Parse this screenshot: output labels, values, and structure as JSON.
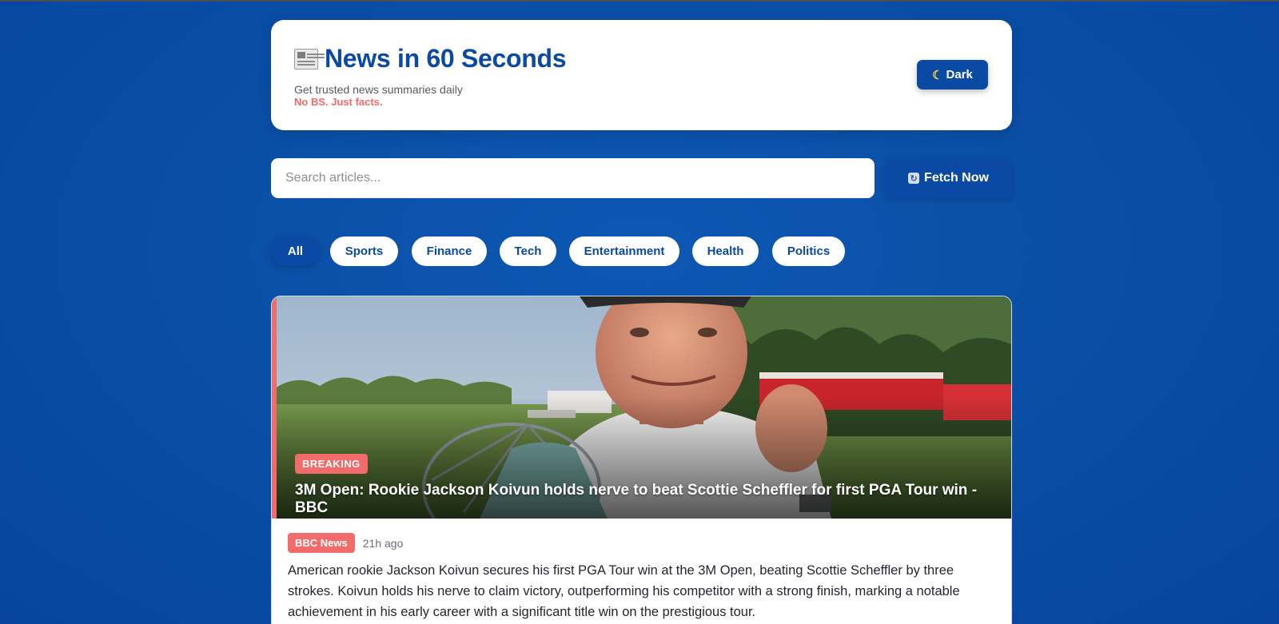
{
  "header": {
    "title": "News in 60 Seconds",
    "subtitle": "Get trusted news summaries daily",
    "tagline": "No BS. Just facts.",
    "dark_button": "Dark",
    "icon": "newspaper-icon"
  },
  "search": {
    "placeholder": "Search articles...",
    "value": "",
    "fetch_label": "Fetch Now"
  },
  "filters": {
    "items": [
      "All",
      "Sports",
      "Finance",
      "Tech",
      "Entertainment",
      "Health",
      "Politics"
    ],
    "active": "All"
  },
  "article": {
    "badge": "BREAKING",
    "title": "3M Open: Rookie Jackson Koivun holds nerve to beat Scottie Scheffler for first PGA Tour win - BBC",
    "source": "BBC News",
    "time": "21h ago",
    "summary": "American rookie Jackson Koivun secures his first PGA Tour win at the 3M Open, beating Scottie Scheffler by three strokes. Koivun holds his nerve to claim victory, outperforming his competitor with a strong finish, marking a notable achievement in his early career with a significant title win on the prestigious tour."
  },
  "colors": {
    "background": "#0a4fa6",
    "brand": "#0b4aa2",
    "accent": "#f26b6b"
  }
}
